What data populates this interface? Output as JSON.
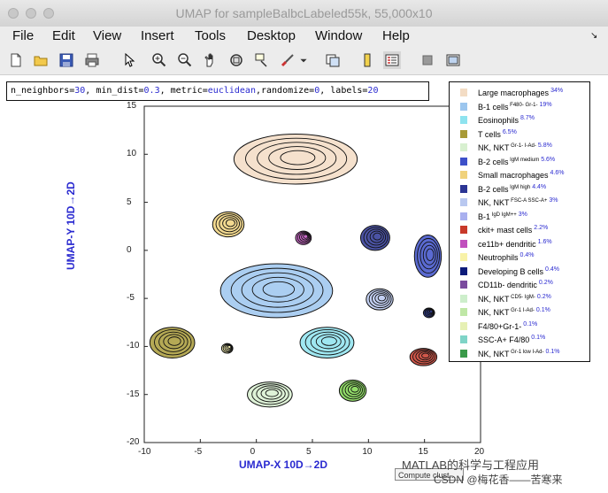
{
  "window": {
    "title": "UMAP for sampleBalbcLabeled55k, 55,000x10"
  },
  "menu": [
    "File",
    "Edit",
    "View",
    "Insert",
    "Tools",
    "Desktop",
    "Window",
    "Help"
  ],
  "toolbar_icons": [
    "new-figure-icon",
    "open-file-icon",
    "save-icon",
    "print-icon",
    "pointer-icon",
    "zoom-in-icon",
    "zoom-out-icon",
    "pan-icon",
    "rotate-3d-icon",
    "data-cursor-icon",
    "brush-icon",
    "brush-dropdown-icon",
    "link-plot-icon",
    "colorbar-icon",
    "legend-icon",
    "hide-plot-tools-icon",
    "show-plot-tools-icon"
  ],
  "params": {
    "n_neighbors_label": "n_neighbors=",
    "n_neighbors": "30",
    "min_dist_label": ", min_dist=",
    "min_dist": "0.3",
    "metric_label": ", metric=",
    "metric": "euclidean",
    "randomize_label": ",randomize=",
    "randomize": "0",
    "labels_label": ", labels=",
    "labels": "20"
  },
  "axes": {
    "xlabel": "UMAP-X  10D→2D",
    "ylabel": "UMAP-Y  10D→2D",
    "xlim": [
      -10,
      20
    ],
    "ylim": [
      -20,
      15
    ],
    "xticks": [
      "-10",
      "-5",
      "0",
      "5",
      "10",
      "15",
      "20"
    ],
    "yticks": [
      "15",
      "10",
      "5",
      "0",
      "-5",
      "-10",
      "-15",
      "-20"
    ]
  },
  "legend": [
    {
      "label": "Large macrophages",
      "sup": "",
      "pct": "34%",
      "color": "#f3dcc4"
    },
    {
      "label": "B-1 cells",
      "sup": "F480- Gr-1-",
      "pct": "19%",
      "color": "#9cc6ee"
    },
    {
      "label": "Eosinophils",
      "sup": "",
      "pct": "8.7%",
      "color": "#8ee3ef"
    },
    {
      "label": "T cells",
      "sup": "",
      "pct": "6.5%",
      "color": "#a89a37"
    },
    {
      "label": "NK, NKT",
      "sup": "Gr-1- I-Ad-",
      "pct": "5.8%",
      "color": "#d8f0d0"
    },
    {
      "label": "B-2 cells",
      "sup": "IgM medium",
      "pct": "5.6%",
      "color": "#3d50c9"
    },
    {
      "label": "Small macrophages",
      "sup": "",
      "pct": "4.6%",
      "color": "#f0d27c"
    },
    {
      "label": "B-2 cells",
      "sup": "IgM high",
      "pct": "4.4%",
      "color": "#2c3594"
    },
    {
      "label": "NK, NKT",
      "sup": "FSC-A SSC-A+",
      "pct": "3%",
      "color": "#b9c8f0"
    },
    {
      "label": "B-1",
      "sup": "IgD IgM++",
      "pct": "3%",
      "color": "#a9b0ef"
    },
    {
      "label": "ckit+ mast cells",
      "sup": "",
      "pct": "2.2%",
      "color": "#c8392a"
    },
    {
      "label": "ce11b+ dendritic",
      "sup": "",
      "pct": "1.6%",
      "color": "#c04fbd"
    },
    {
      "label": "Neutrophils",
      "sup": "",
      "pct": "0.4%",
      "color": "#f8f2a8"
    },
    {
      "label": "Developing B cells",
      "sup": "",
      "pct": "0.4%",
      "color": "#0d1b7a"
    },
    {
      "label": "CD11b- dendritic",
      "sup": "",
      "pct": "0.2%",
      "color": "#7a4b9e"
    },
    {
      "label": "NK, NKT",
      "sup": "CD5- IgM-",
      "pct": "0.2%",
      "color": "#cdeecb"
    },
    {
      "label": "NK, NKT",
      "sup": "Gr-1 I-Ad-",
      "pct": "0.1%",
      "color": "#bfe7a6"
    },
    {
      "label": "F4/80+Gr-1-",
      "sup": "",
      "pct": "0.1%",
      "color": "#e6f0b4"
    },
    {
      "label": "SSC-A+ F4/80",
      "sup": "",
      "pct": "0.1%",
      "color": "#7fd4c7"
    },
    {
      "label": "NK, NKT",
      "sup": "Gr-1 low I-Ad-",
      "pct": "0.1%",
      "color": "#3a9a4a"
    }
  ],
  "compute_button": "Compute clust...",
  "watermark1": "MATLAB的科学与工程应用",
  "watermark2": "CSDN @梅花香——苦寒来",
  "chart_data": {
    "type": "scatter",
    "xlabel": "UMAP-X  10D→2D",
    "ylabel": "UMAP-Y  10D→2D",
    "xlim": [
      -10,
      20
    ],
    "ylim": [
      -20,
      15
    ],
    "clusters": [
      {
        "name": "Large macrophages",
        "cx": 3.5,
        "cy": 9.5,
        "rx": 5.5,
        "ry": 2.6,
        "color": "#f3dcc4"
      },
      {
        "name": "B-1 cells F480- Gr-1-",
        "cx": 1.8,
        "cy": -4.2,
        "rx": 5.0,
        "ry": 2.8,
        "color": "#9cc6ee"
      },
      {
        "name": "Eosinophils",
        "cx": 6.3,
        "cy": -9.6,
        "rx": 2.4,
        "ry": 1.6,
        "color": "#8ee3ef"
      },
      {
        "name": "T cells",
        "cx": -7.5,
        "cy": -9.6,
        "rx": 2.0,
        "ry": 1.6,
        "color": "#a89a37"
      },
      {
        "name": "NK, NKT Gr-1- I-Ad-",
        "cx": 1.2,
        "cy": -15.0,
        "rx": 2.0,
        "ry": 1.3,
        "color": "#d8f0d0"
      },
      {
        "name": "B-2 cells IgM medium",
        "cx": 15.3,
        "cy": -0.6,
        "rx": 1.2,
        "ry": 2.2,
        "color": "#3d50c9"
      },
      {
        "name": "Small macrophages",
        "cx": -2.5,
        "cy": 2.7,
        "rx": 1.4,
        "ry": 1.3,
        "color": "#f0d27c"
      },
      {
        "name": "B-2 cells IgM high",
        "cx": 10.6,
        "cy": 1.3,
        "rx": 1.3,
        "ry": 1.3,
        "color": "#2c3594"
      },
      {
        "name": "NK, NKT FSC-A SSC-A+",
        "cx": 11.0,
        "cy": -5.1,
        "rx": 1.2,
        "ry": 1.1,
        "color": "#b9c8f0"
      },
      {
        "name": "ckit+ mast cells",
        "cx": 14.9,
        "cy": -11.1,
        "rx": 1.2,
        "ry": 0.9,
        "color": "#c8392a"
      },
      {
        "name": "ce11b+ dendritic",
        "cx": 4.2,
        "cy": 1.3,
        "rx": 0.7,
        "ry": 0.7,
        "color": "#c04fbd"
      },
      {
        "name": "Neutrophils",
        "cx": -2.6,
        "cy": -10.2,
        "rx": 0.5,
        "ry": 0.5,
        "color": "#f8f2a8"
      },
      {
        "name": "Developing B cells",
        "cx": 15.4,
        "cy": -6.5,
        "rx": 0.5,
        "ry": 0.5,
        "color": "#0d1b7a"
      },
      {
        "name": "NK, NKT Gr-1 I-Ad-",
        "cx": 8.6,
        "cy": -14.6,
        "rx": 1.2,
        "ry": 1.1,
        "color": "#7fd64f"
      }
    ]
  }
}
